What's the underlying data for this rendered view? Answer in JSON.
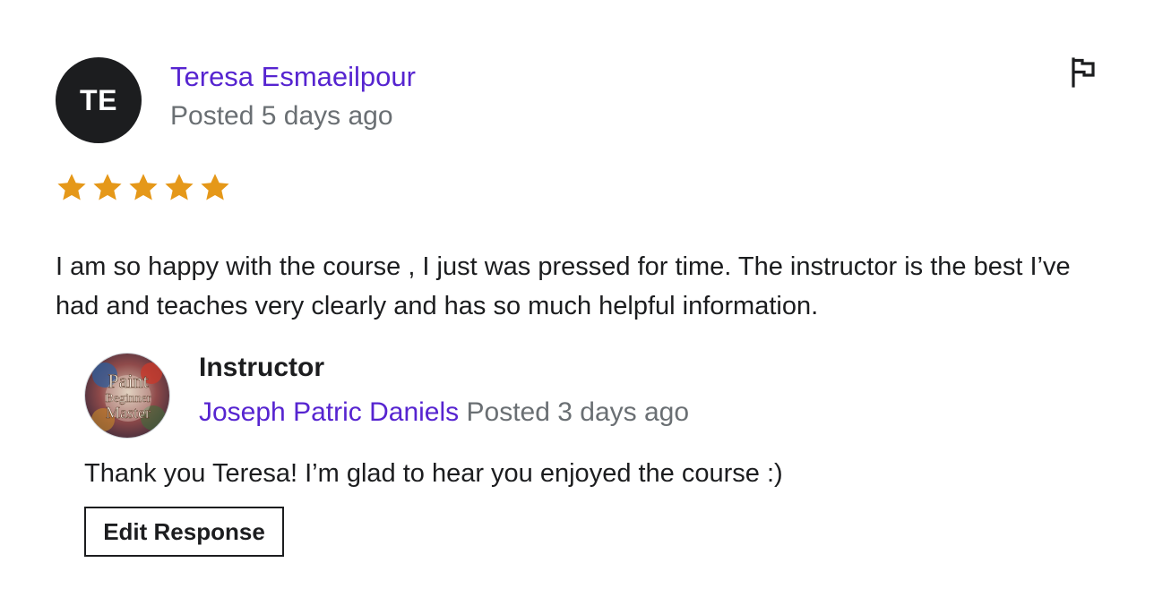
{
  "review": {
    "avatar_initials": "TE",
    "reviewer_name": "Teresa Esmaeilpour",
    "posted": "Posted 5 days ago",
    "rating": 5,
    "rating_max": 5,
    "star_color": "#e59819",
    "text": "I am so happy with the course , I just was pressed for time. The instructor is the best I’ve had and teaches very clearly and has so much helpful information.",
    "report_icon": "flag-icon"
  },
  "response": {
    "avatar_text": [
      "Paint",
      "Beginner",
      "Master"
    ],
    "role_label": "Instructor",
    "instructor_name": "Joseph Patric Daniels",
    "posted": "Posted 3 days ago",
    "text": "Thank you Teresa! I’m glad to hear you enjoyed the course :)",
    "edit_label": "Edit Response"
  },
  "colors": {
    "link": "#5624d0",
    "muted": "#6a6f73",
    "text": "#1c1d1f"
  }
}
